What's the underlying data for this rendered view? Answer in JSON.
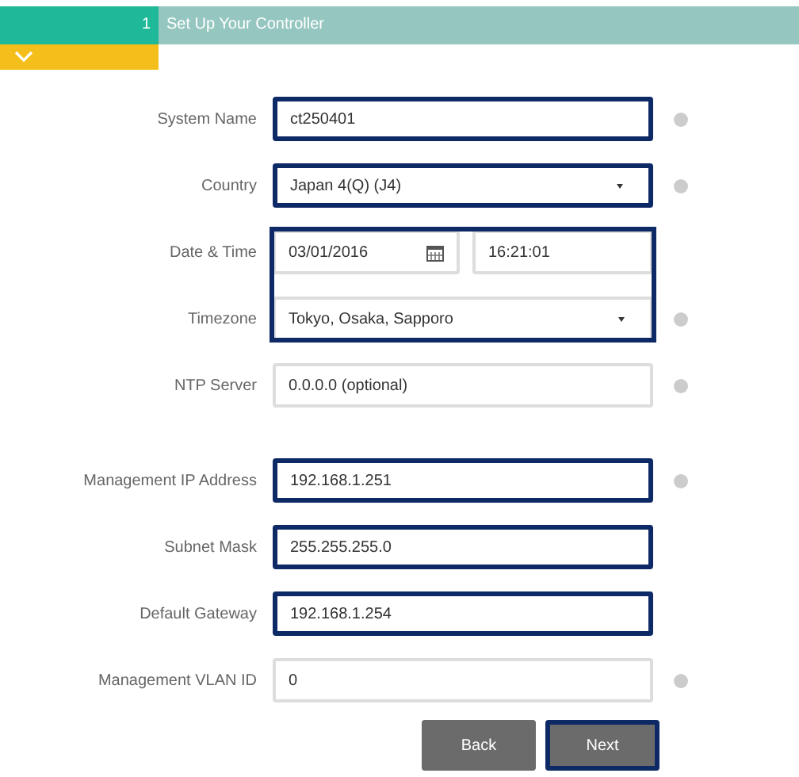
{
  "step": {
    "number": "1",
    "title": "Set Up Your Controller",
    "expanded": true
  },
  "sections": [
    [
      {
        "kind": "text",
        "label": "System Name",
        "value": "ct250401",
        "highlighted": true,
        "help": true
      },
      {
        "kind": "select",
        "label": "Country",
        "value": "Japan 4(Q) (J4)",
        "highlighted": true,
        "help": true
      },
      {
        "kind": "group",
        "highlighted": true,
        "rows": [
          {
            "kind": "datetime",
            "label": "Date & Time",
            "date": "03/01/2016",
            "time": "16:21:01",
            "help": false
          },
          {
            "kind": "select",
            "label": "Timezone",
            "value": "Tokyo, Osaka, Sapporo",
            "highlighted": false,
            "help": true
          }
        ]
      },
      {
        "kind": "text",
        "label": "NTP Server",
        "value": "0.0.0.0 (optional)",
        "highlighted": false,
        "help": true
      }
    ],
    [
      {
        "kind": "text",
        "label": "Management IP Address",
        "value": "192.168.1.251",
        "highlighted": true,
        "help": true
      },
      {
        "kind": "text",
        "label": "Subnet Mask",
        "value": "255.255.255.0",
        "highlighted": true,
        "help": false
      },
      {
        "kind": "text",
        "label": "Default Gateway",
        "value": "192.168.1.254",
        "highlighted": true,
        "help": false
      },
      {
        "kind": "text",
        "label": "Management VLAN ID",
        "value": "0",
        "highlighted": false,
        "help": true
      }
    ]
  ],
  "buttons": [
    {
      "label": "Back",
      "highlighted": false
    },
    {
      "label": "Next",
      "highlighted": true
    }
  ]
}
